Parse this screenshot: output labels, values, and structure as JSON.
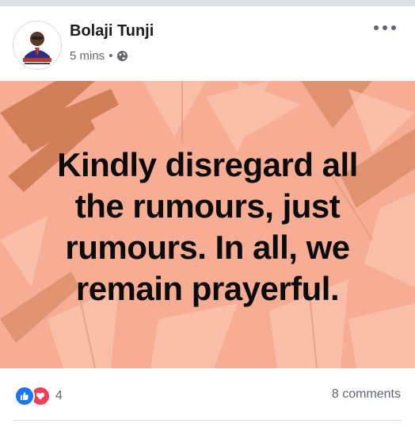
{
  "post": {
    "author": "Bolaji Tunji",
    "time": "5 mins",
    "separator": "•",
    "privacy_icon": "globe-icon",
    "more_icon": "more-options-icon",
    "image_text_lines": [
      "Kindly disregard all",
      "the rumours, just",
      "rumours. In all, we",
      "remain prayerful."
    ]
  },
  "footer": {
    "reaction_icons": [
      "like-icon",
      "love-icon"
    ],
    "reaction_count": "4",
    "comments_label": "8 comments"
  },
  "colors": {
    "background_peach": "#f6ad93",
    "leaf_dark": "#c9764f",
    "leaf_light": "#f9c4ae",
    "like_blue": "#1877f2",
    "love_red": "#f33e58",
    "text_dark": "#1c1e21",
    "text_gray": "#65676b"
  }
}
